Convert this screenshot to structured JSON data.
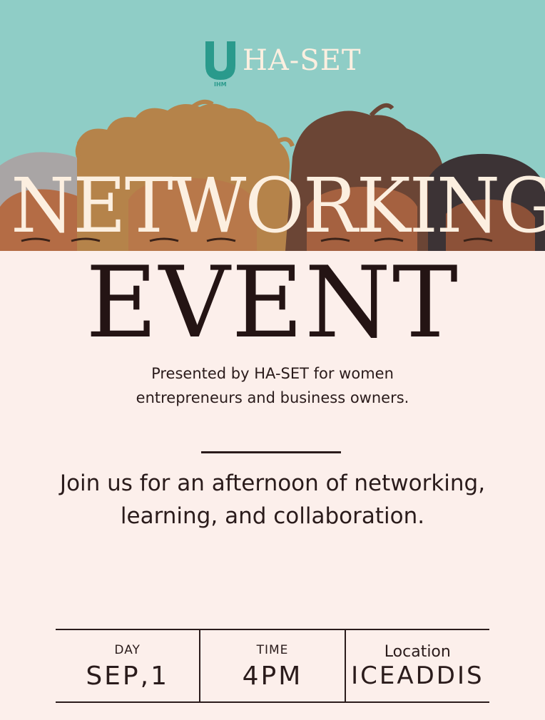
{
  "brand": {
    "name": "HA-SET",
    "small_mark": "IHM",
    "color": "#2a9a8c"
  },
  "title": {
    "line1": "NETWORKING",
    "line2": "EVENT"
  },
  "presented": {
    "line1": "Presented by HA-SET for women",
    "line2": "entrepreneurs and business owners."
  },
  "invite": {
    "line1": "Join us for an afternoon of networking,",
    "line2": "learning, and collaboration."
  },
  "details": {
    "day_label": "DAY",
    "day_value": "SEP,1",
    "time_label": "TIME",
    "time_value": "4PM",
    "location_label": "Location",
    "location_value": "ICEADDIS"
  },
  "colors": {
    "sky": "#8fcdc6",
    "background": "#fcefeb",
    "text": "#2a1b1b"
  }
}
